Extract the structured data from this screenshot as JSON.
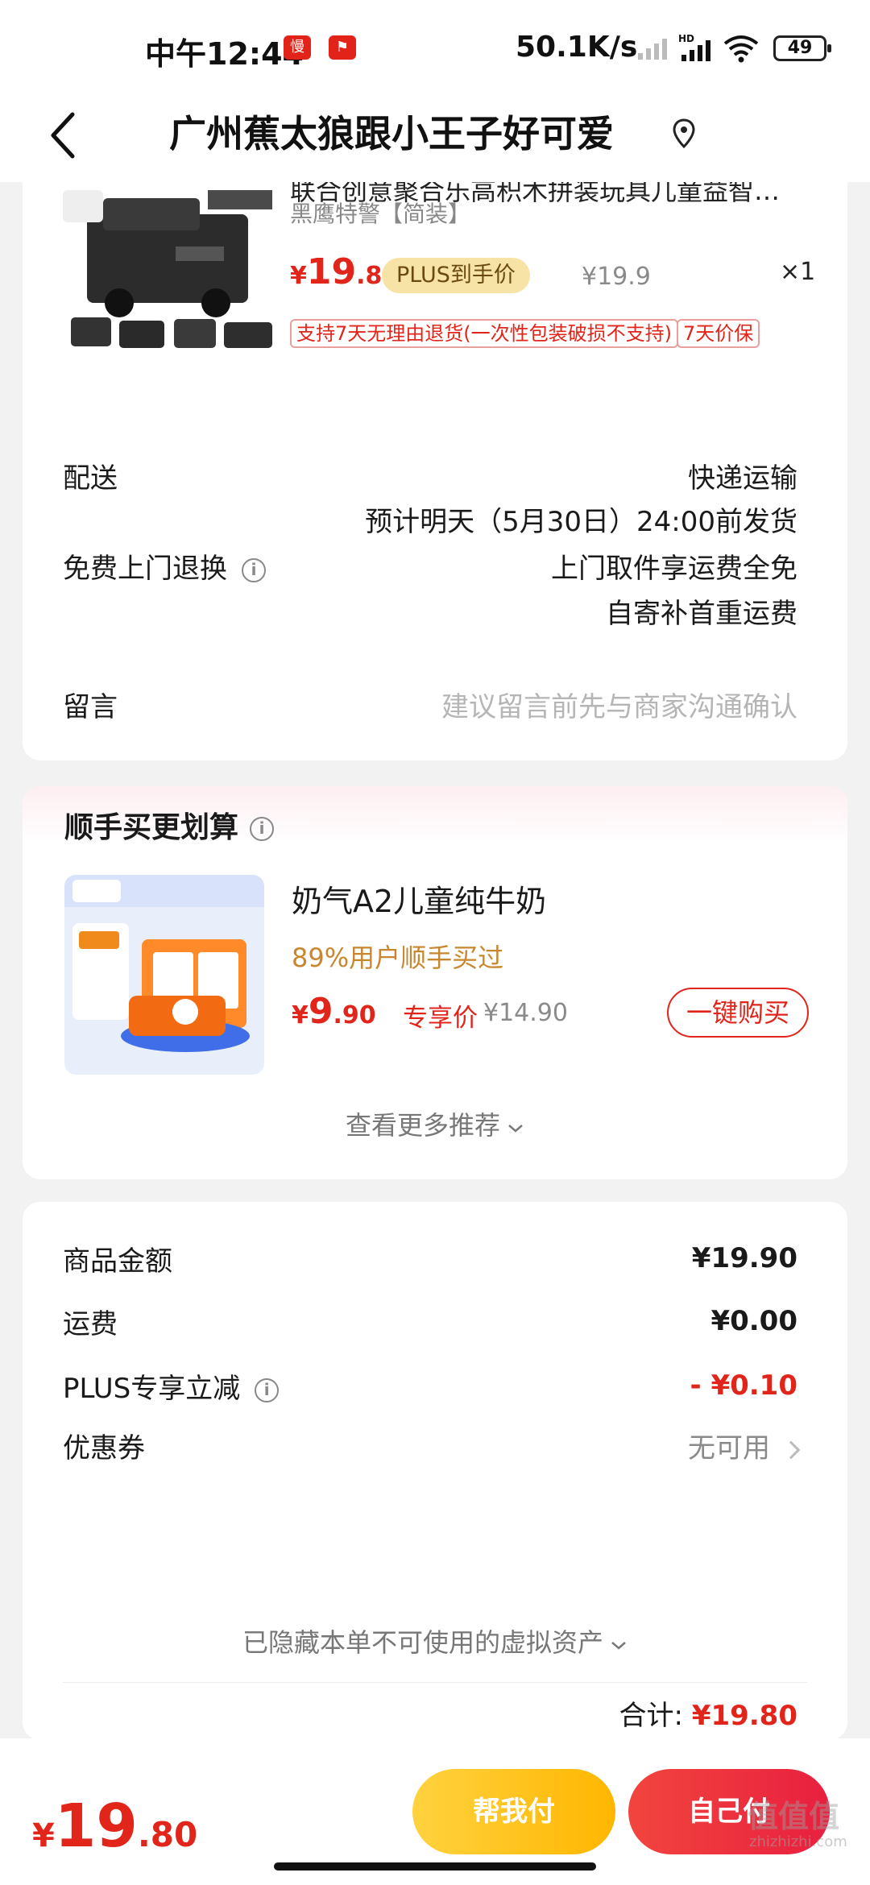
{
  "status_bar": {
    "time": "中午12:44",
    "speed": "50.1K/s",
    "hd_label": "HD",
    "battery": "49",
    "icons": [
      "app-notification-icon",
      "app-notification-icon",
      "signal-bars-icon",
      "hd-signal-icon",
      "wifi-icon",
      "battery-icon"
    ]
  },
  "header": {
    "title": "广州蕉太狼跟小王子好可爱",
    "back_icon": "chevron-left-icon",
    "location_icon": "location-pin-icon"
  },
  "product": {
    "title": "联合创意聚合乐高积木拼装玩具儿童益智男孩警察车",
    "spec": "黑鹰特警【简装】",
    "price_yen": "¥",
    "price_int": "19",
    "price_dec": ".8",
    "plus_tag": "PLUS到手价",
    "original_price": "¥19.9",
    "quantity": "×1",
    "service_tags": [
      "支持7天无理由退货(一次性包装破损不支持)",
      "7天价保"
    ]
  },
  "delivery": {
    "label": "配送",
    "method": "快递运输",
    "estimate": "预计明天（5月30日）24:00前发货"
  },
  "returns": {
    "label": "免费上门退换",
    "line1": "上门取件享运费全免",
    "line2": "自寄补首重运费"
  },
  "message": {
    "label": "留言",
    "placeholder": "建议留言前先与商家沟通确认"
  },
  "recommend": {
    "title": "顺手买更划算",
    "product_name": "奶气A2儿童纯牛奶",
    "social_proof": "89%用户顺手买过",
    "price_yen": "¥",
    "price_int": "9",
    "price_dec": ".90",
    "exclusive_label": "专享价",
    "original_price": "¥14.90",
    "buy_button": "一键购买",
    "more_link": "查看更多推荐"
  },
  "summary": {
    "goods_label": "商品金额",
    "goods_value": "¥19.90",
    "shipping_label": "运费",
    "shipping_value": "¥0.00",
    "plus_label": "PLUS专享立减",
    "plus_value": "- ¥0.10",
    "coupon_label": "优惠券",
    "coupon_value": "无可用",
    "hidden_assets": "已隐藏本单不可使用的虚拟资产",
    "total_label": "合计:",
    "total_value": "¥19.80"
  },
  "bottom_bar": {
    "yen": "¥",
    "amount_int": "19",
    "amount_dec": ".80",
    "help_pay": "帮我付",
    "self_pay": "自己付",
    "watermark": "值值值",
    "watermark_sub": "zhizhizhi.com"
  },
  "colors": {
    "accent_red": "#e1251b",
    "plus_gold": "#f7e3a6",
    "help_yellow": "#ffc21a"
  }
}
